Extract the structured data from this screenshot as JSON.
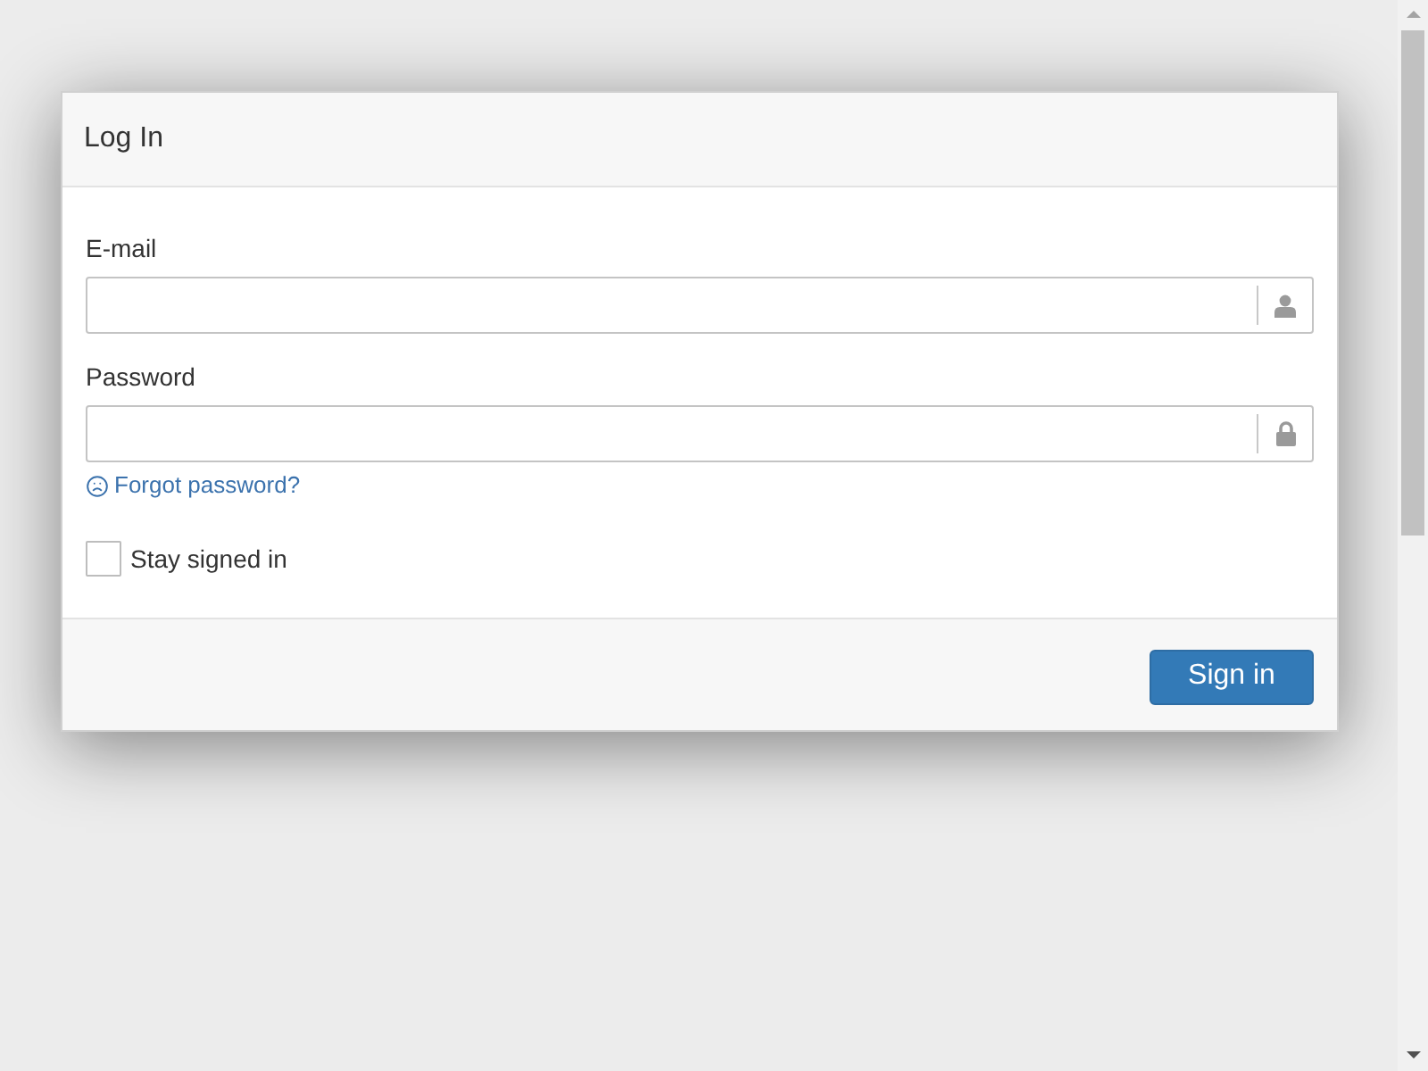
{
  "dialog": {
    "title": "Log In",
    "fields": [
      {
        "label": "E-mail",
        "kind": "email"
      },
      {
        "label": "Password",
        "kind": "password"
      }
    ],
    "forgot_link": "Forgot password?",
    "stay_signed_in": {
      "label": "Stay signed in",
      "checked": false
    },
    "submit_button": "Sign in"
  }
}
